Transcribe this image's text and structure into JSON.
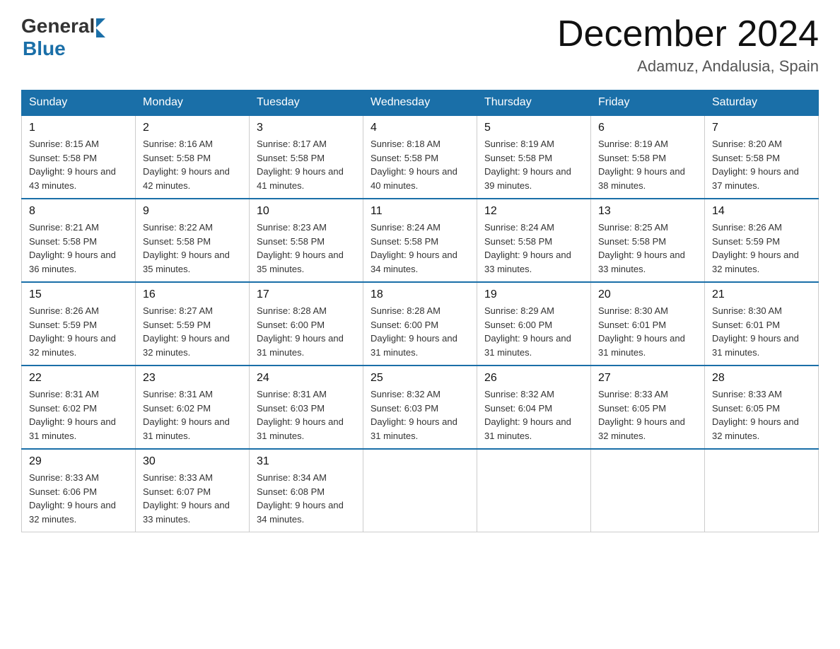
{
  "header": {
    "logo_general": "General",
    "logo_blue": "Blue",
    "month_title": "December 2024",
    "location": "Adamuz, Andalusia, Spain"
  },
  "weekdays": [
    "Sunday",
    "Monday",
    "Tuesday",
    "Wednesday",
    "Thursday",
    "Friday",
    "Saturday"
  ],
  "weeks": [
    [
      {
        "day": "1",
        "sunrise": "8:15 AM",
        "sunset": "5:58 PM",
        "daylight": "9 hours and 43 minutes."
      },
      {
        "day": "2",
        "sunrise": "8:16 AM",
        "sunset": "5:58 PM",
        "daylight": "9 hours and 42 minutes."
      },
      {
        "day": "3",
        "sunrise": "8:17 AM",
        "sunset": "5:58 PM",
        "daylight": "9 hours and 41 minutes."
      },
      {
        "day": "4",
        "sunrise": "8:18 AM",
        "sunset": "5:58 PM",
        "daylight": "9 hours and 40 minutes."
      },
      {
        "day": "5",
        "sunrise": "8:19 AM",
        "sunset": "5:58 PM",
        "daylight": "9 hours and 39 minutes."
      },
      {
        "day": "6",
        "sunrise": "8:19 AM",
        "sunset": "5:58 PM",
        "daylight": "9 hours and 38 minutes."
      },
      {
        "day": "7",
        "sunrise": "8:20 AM",
        "sunset": "5:58 PM",
        "daylight": "9 hours and 37 minutes."
      }
    ],
    [
      {
        "day": "8",
        "sunrise": "8:21 AM",
        "sunset": "5:58 PM",
        "daylight": "9 hours and 36 minutes."
      },
      {
        "day": "9",
        "sunrise": "8:22 AM",
        "sunset": "5:58 PM",
        "daylight": "9 hours and 35 minutes."
      },
      {
        "day": "10",
        "sunrise": "8:23 AM",
        "sunset": "5:58 PM",
        "daylight": "9 hours and 35 minutes."
      },
      {
        "day": "11",
        "sunrise": "8:24 AM",
        "sunset": "5:58 PM",
        "daylight": "9 hours and 34 minutes."
      },
      {
        "day": "12",
        "sunrise": "8:24 AM",
        "sunset": "5:58 PM",
        "daylight": "9 hours and 33 minutes."
      },
      {
        "day": "13",
        "sunrise": "8:25 AM",
        "sunset": "5:58 PM",
        "daylight": "9 hours and 33 minutes."
      },
      {
        "day": "14",
        "sunrise": "8:26 AM",
        "sunset": "5:59 PM",
        "daylight": "9 hours and 32 minutes."
      }
    ],
    [
      {
        "day": "15",
        "sunrise": "8:26 AM",
        "sunset": "5:59 PM",
        "daylight": "9 hours and 32 minutes."
      },
      {
        "day": "16",
        "sunrise": "8:27 AM",
        "sunset": "5:59 PM",
        "daylight": "9 hours and 32 minutes."
      },
      {
        "day": "17",
        "sunrise": "8:28 AM",
        "sunset": "6:00 PM",
        "daylight": "9 hours and 31 minutes."
      },
      {
        "day": "18",
        "sunrise": "8:28 AM",
        "sunset": "6:00 PM",
        "daylight": "9 hours and 31 minutes."
      },
      {
        "day": "19",
        "sunrise": "8:29 AM",
        "sunset": "6:00 PM",
        "daylight": "9 hours and 31 minutes."
      },
      {
        "day": "20",
        "sunrise": "8:30 AM",
        "sunset": "6:01 PM",
        "daylight": "9 hours and 31 minutes."
      },
      {
        "day": "21",
        "sunrise": "8:30 AM",
        "sunset": "6:01 PM",
        "daylight": "9 hours and 31 minutes."
      }
    ],
    [
      {
        "day": "22",
        "sunrise": "8:31 AM",
        "sunset": "6:02 PM",
        "daylight": "9 hours and 31 minutes."
      },
      {
        "day": "23",
        "sunrise": "8:31 AM",
        "sunset": "6:02 PM",
        "daylight": "9 hours and 31 minutes."
      },
      {
        "day": "24",
        "sunrise": "8:31 AM",
        "sunset": "6:03 PM",
        "daylight": "9 hours and 31 minutes."
      },
      {
        "day": "25",
        "sunrise": "8:32 AM",
        "sunset": "6:03 PM",
        "daylight": "9 hours and 31 minutes."
      },
      {
        "day": "26",
        "sunrise": "8:32 AM",
        "sunset": "6:04 PM",
        "daylight": "9 hours and 31 minutes."
      },
      {
        "day": "27",
        "sunrise": "8:33 AM",
        "sunset": "6:05 PM",
        "daylight": "9 hours and 32 minutes."
      },
      {
        "day": "28",
        "sunrise": "8:33 AM",
        "sunset": "6:05 PM",
        "daylight": "9 hours and 32 minutes."
      }
    ],
    [
      {
        "day": "29",
        "sunrise": "8:33 AM",
        "sunset": "6:06 PM",
        "daylight": "9 hours and 32 minutes."
      },
      {
        "day": "30",
        "sunrise": "8:33 AM",
        "sunset": "6:07 PM",
        "daylight": "9 hours and 33 minutes."
      },
      {
        "day": "31",
        "sunrise": "8:34 AM",
        "sunset": "6:08 PM",
        "daylight": "9 hours and 34 minutes."
      },
      null,
      null,
      null,
      null
    ]
  ]
}
